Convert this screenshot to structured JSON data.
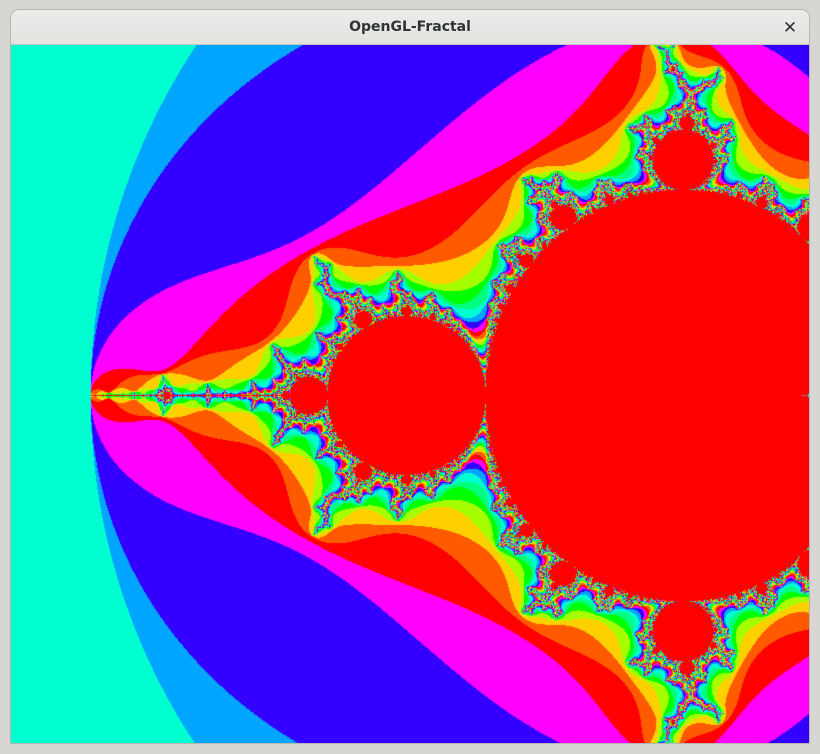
{
  "window": {
    "title": "OpenGL-Fractal",
    "close_glyph": "✕",
    "close_icon": "close-icon"
  },
  "render": {
    "content": "mandelbrot-set",
    "max_iterations": 256,
    "palette": [
      "#ff0000",
      "#ff5a00",
      "#ffd000",
      "#a6ff00",
      "#00ff00",
      "#00ff80",
      "#00ffd0",
      "#00a5ff",
      "#3300ff",
      "#ff00ff"
    ],
    "inside_color": "#ff0000"
  }
}
